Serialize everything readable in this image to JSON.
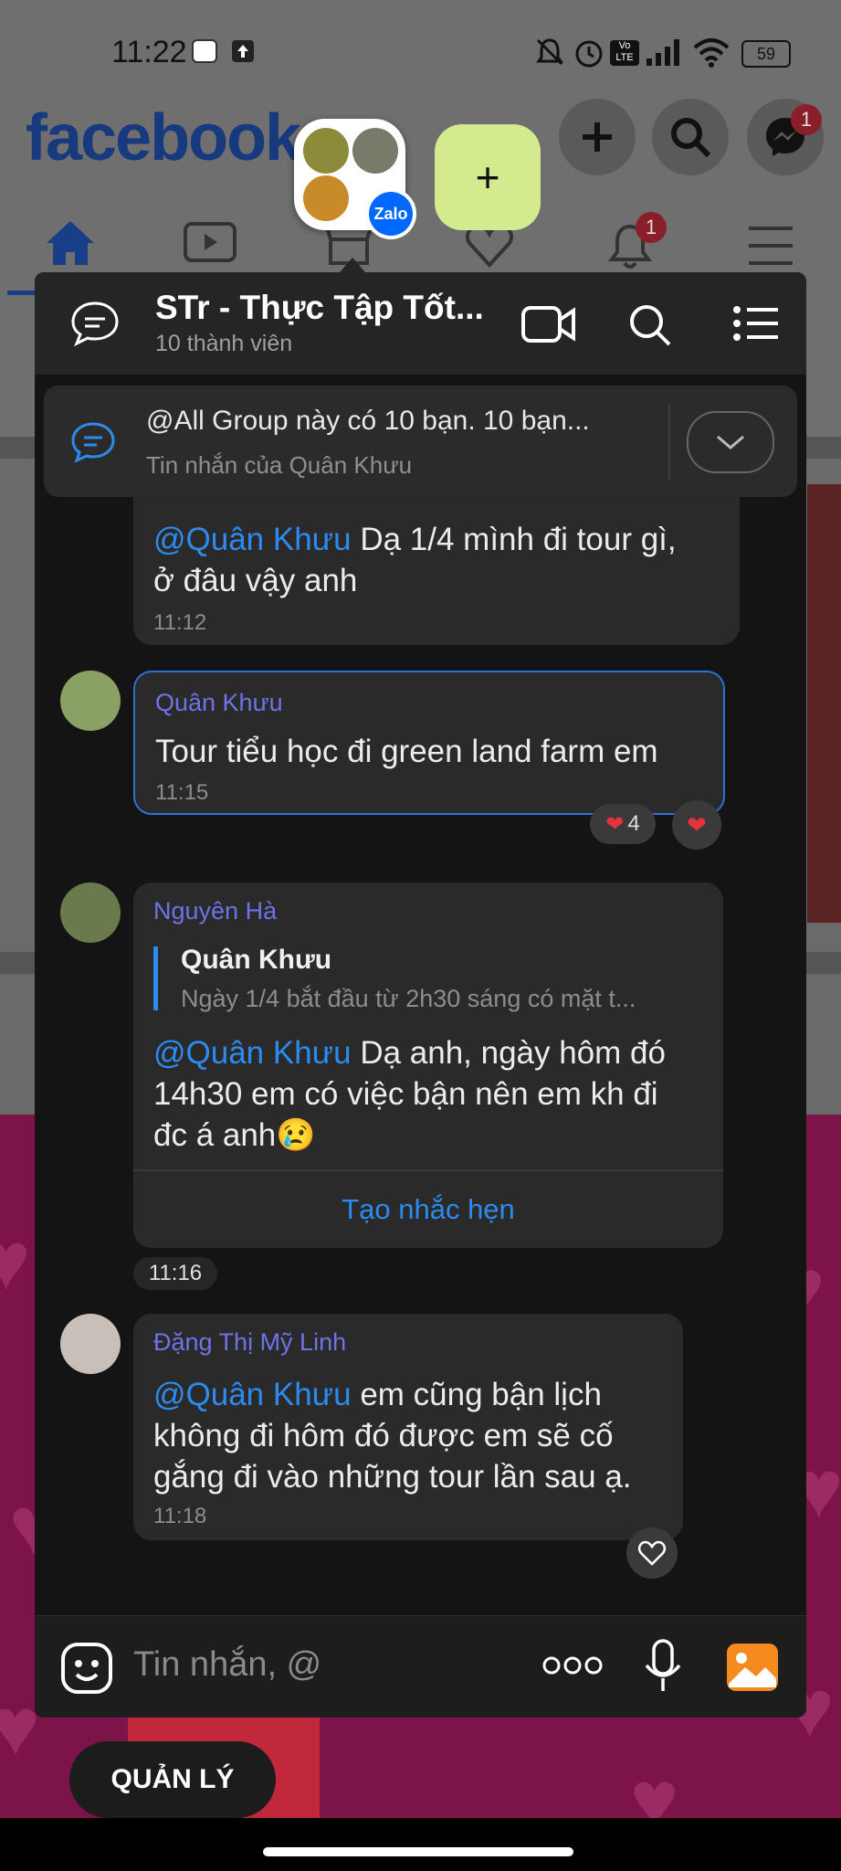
{
  "status_bar": {
    "time": "11:22",
    "lte": "Vo LTE",
    "battery": "59"
  },
  "facebook": {
    "logo": "facebook",
    "messenger_badge": "1",
    "notification_badge": "1"
  },
  "bubble": {
    "app_badge": "Zalo",
    "add_label": "+"
  },
  "chat": {
    "title": "STr - Thực Tập Tốt...",
    "members": "10 thành viên",
    "pinned": {
      "text": "@All Group này có 10 bạn. 10 bạn...",
      "from": "Tin nhắn của Quân Khưu"
    },
    "messages": [
      {
        "mention": "@Quân Khưu",
        "text_line1": " Dạ 1/4 mình đi tour gì,",
        "text_line2": "ở đâu vậy anh",
        "time": "11:12"
      },
      {
        "sender": "Quân Khưu",
        "text": "Tour tiểu học đi green land farm em",
        "time": "11:15",
        "reaction_count": "4"
      },
      {
        "sender": "Nguyên Hà",
        "quote_name": "Quân Khưu",
        "quote_text": "Ngày 1/4 bắt đầu từ 2h30 sáng có mặt t...",
        "mention": "@Quân Khưu",
        "text_line1": " Dạ anh, ngày hôm đó",
        "text_line2": "14h30 em có việc bận nên em kh đi",
        "text_line3": "đc á anh😢",
        "action": "Tạo nhắc hẹn",
        "time": "11:16"
      },
      {
        "sender": "Đặng Thị Mỹ Linh",
        "mention": "@Quân Khưu",
        "text_line1": " em cũng bận lịch",
        "text_line2": "không đi hôm đó được em sẽ cố",
        "text_line3": "gắng đi vào những tour lần sau ạ.",
        "time": "11:18"
      }
    ],
    "input_placeholder": "Tin nhắn, @"
  },
  "manage_button": "QUẢN LÝ",
  "colors": {
    "accent": "#2d8bf0",
    "sender": "#6e73e8",
    "panel": "#141414",
    "bubble_add": "#d3ea8f"
  }
}
